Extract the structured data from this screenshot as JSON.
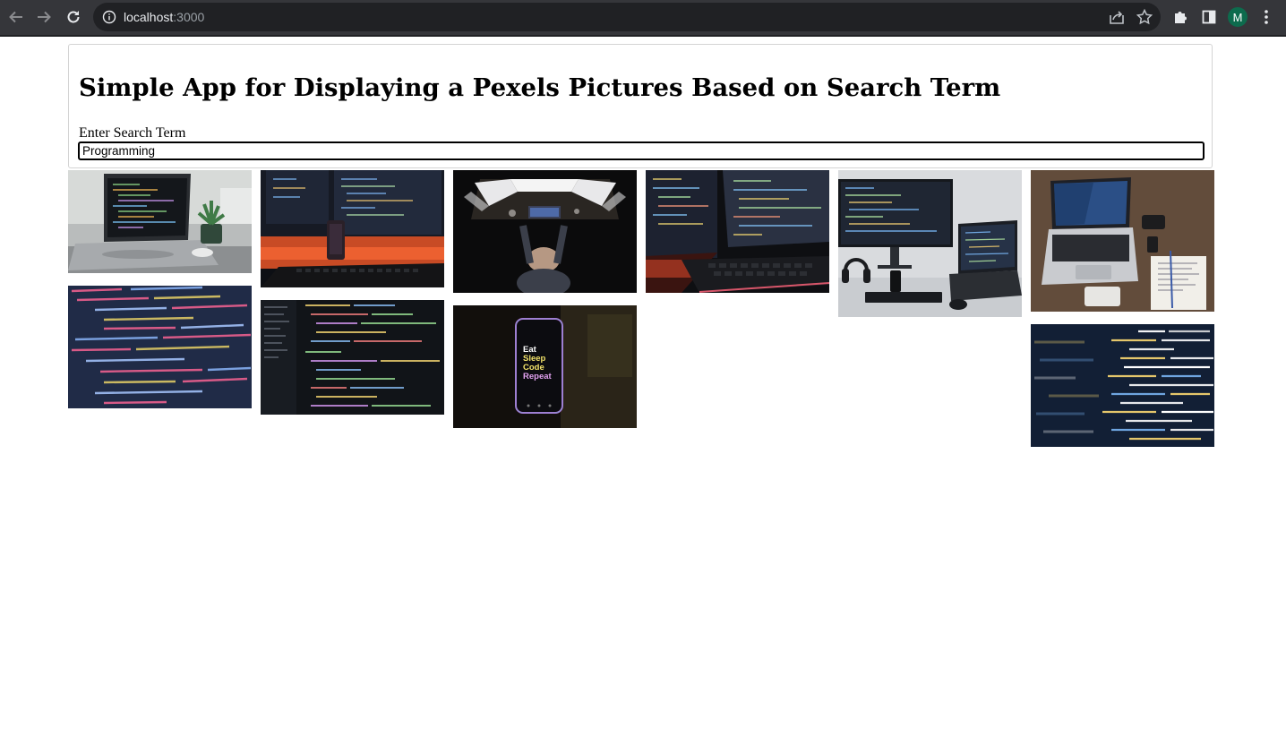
{
  "browser": {
    "url_host": "localhost",
    "url_port": ":3000",
    "profile_initial": "M"
  },
  "app": {
    "title": "Simple App for Displaying a Pexels Pictures Based on Search Term",
    "search_label": "Enter Search Term",
    "search_value": "Programming"
  },
  "photo_screen_text": {
    "phone_lines": [
      "Eat",
      "Sleep",
      "Code",
      "Repeat"
    ]
  }
}
